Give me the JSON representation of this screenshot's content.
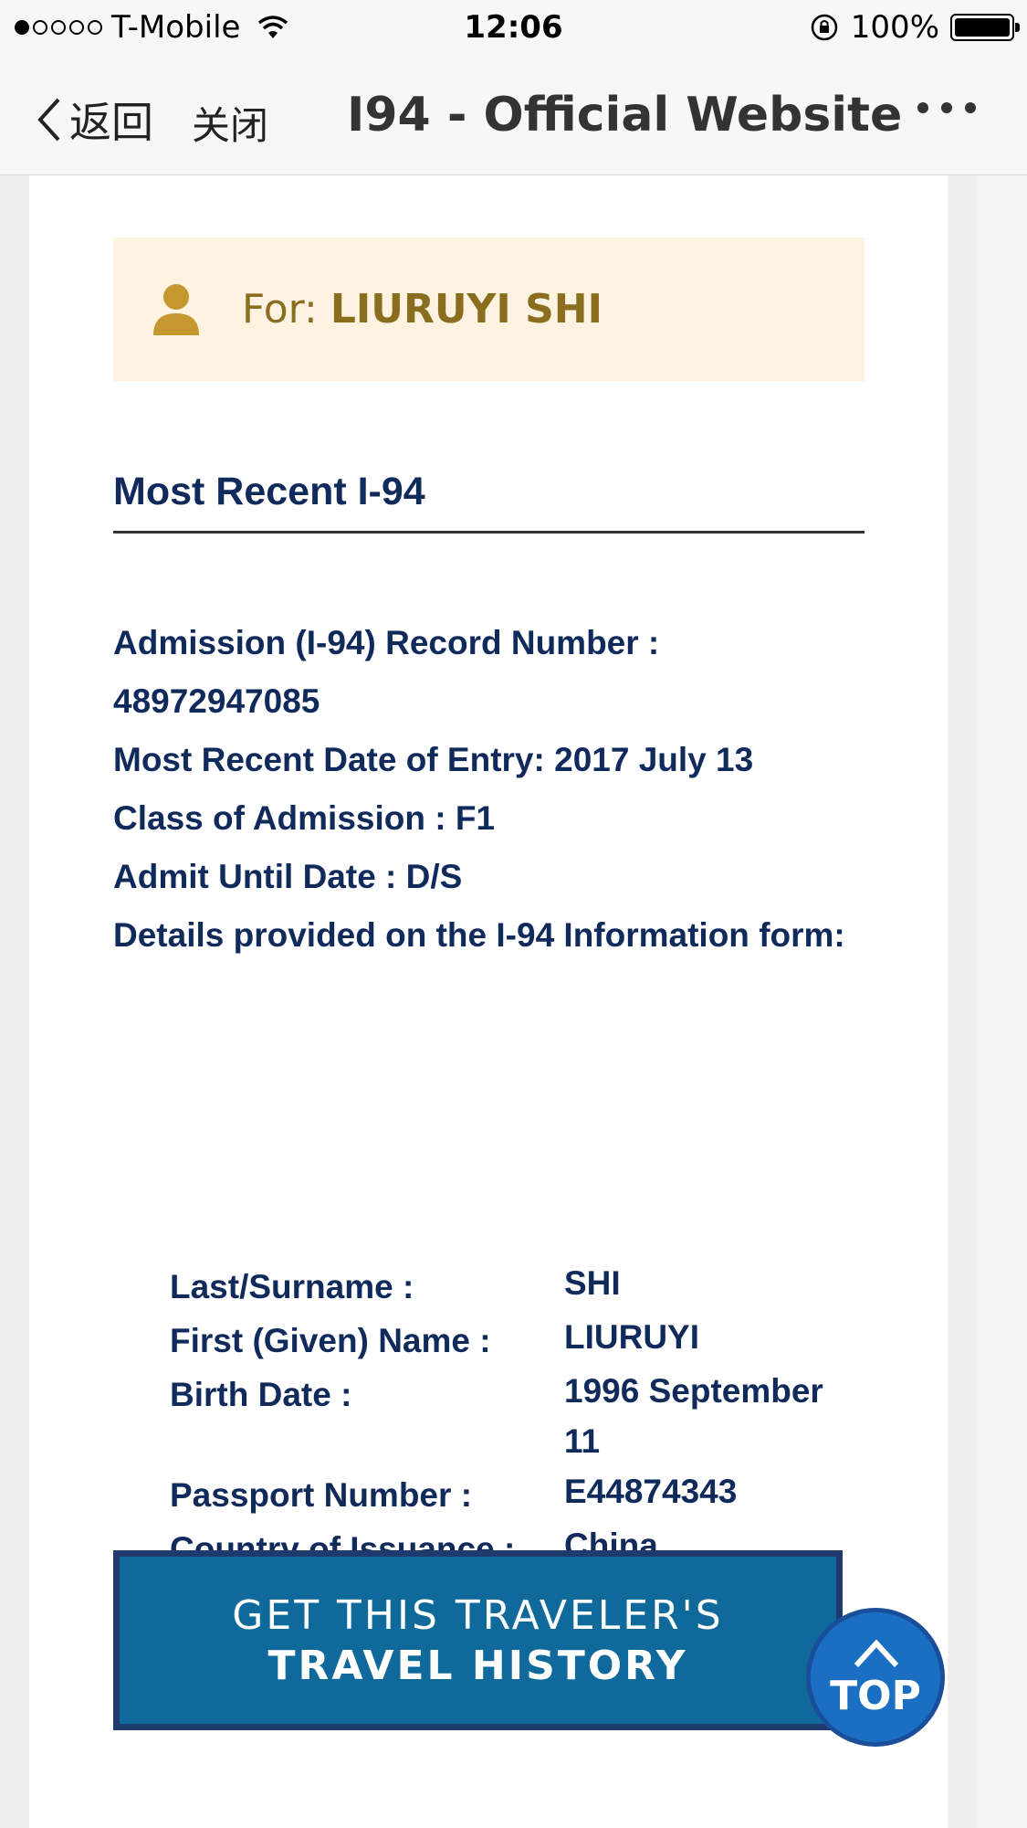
{
  "status_bar": {
    "carrier": "T-Mobile",
    "time": "12:06",
    "battery": "100%",
    "signal_bars_filled": 1,
    "signal_bars_total": 5
  },
  "nav": {
    "back_label": "返回",
    "close_label": "关闭",
    "title": "I94 - Official Website"
  },
  "traveler": {
    "for_prefix": "For:",
    "name": "LIURUYI SHI"
  },
  "section_title": "Most Recent I-94",
  "record": {
    "admission_number_label": "Admission (I-94) Record Number :",
    "admission_number": "48972947085",
    "entry_date_line": "Most Recent Date of Entry: 2017 July 13",
    "class_line": "Class of Admission : F1",
    "admit_until_line": "Admit Until Date : D/S",
    "details_intro": "Details provided on the I-94 Information form:"
  },
  "details": [
    {
      "label": "Last/Surname :",
      "value": "SHI"
    },
    {
      "label": "First (Given) Name :",
      "value": "LIURUYI"
    },
    {
      "label": "Birth Date :",
      "value": "1996 September 11"
    },
    {
      "label": "Passport Number :",
      "value": "E44874343"
    },
    {
      "label": "Country of Issuance :",
      "value": "China"
    }
  ],
  "travel_history_button": {
    "line1": "GET THIS TRAVELER'S",
    "line2": "TRAVEL HISTORY"
  },
  "top_button": {
    "label": "TOP"
  },
  "colors": {
    "heading_navy": "#102a5c",
    "banner_bg": "#fdf3e0",
    "banner_gold": "#8a6d1e",
    "button_blue": "#0f6a9b",
    "top_blue": "#1a6fc3"
  }
}
